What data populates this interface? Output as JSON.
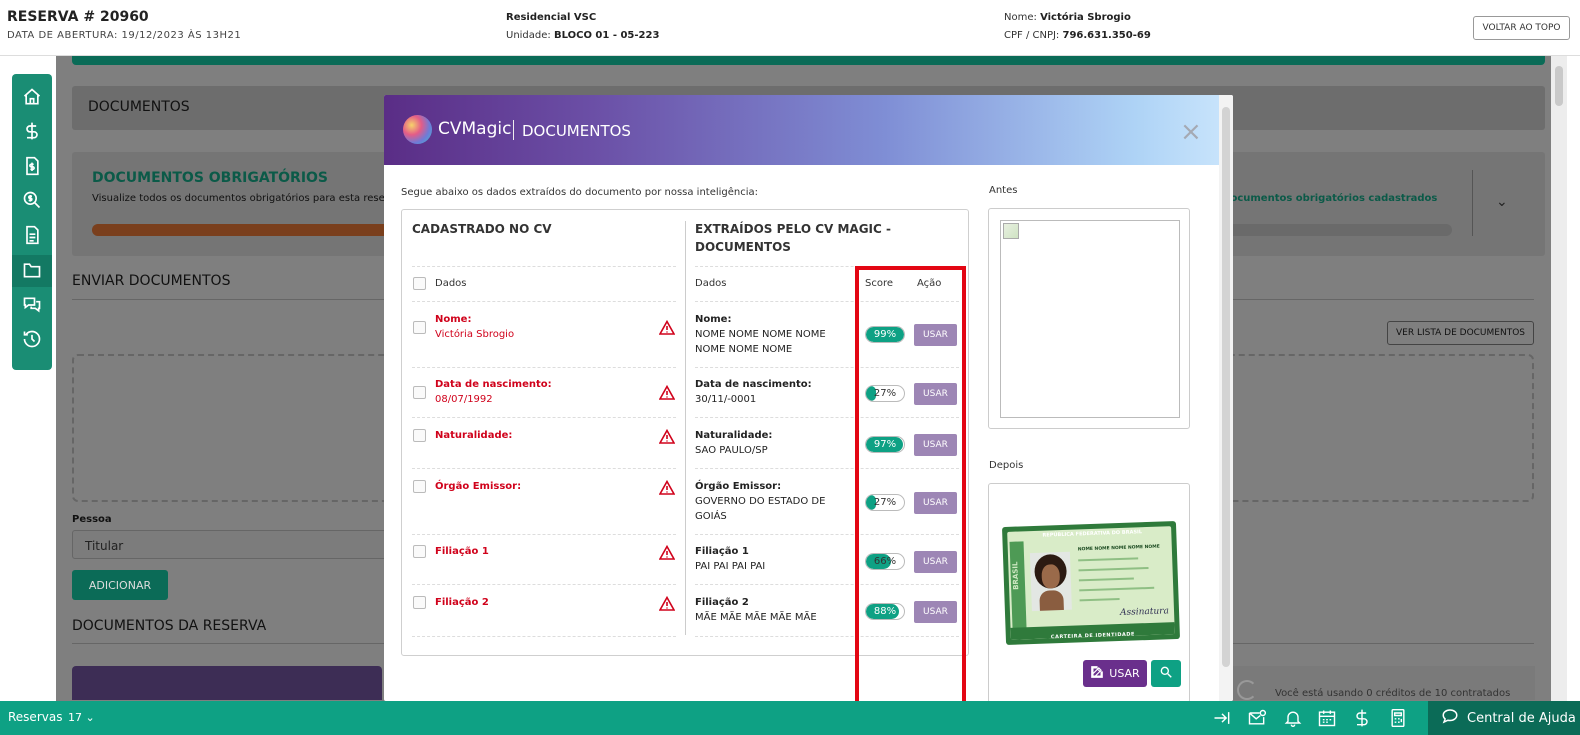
{
  "header": {
    "reserva_title": "RESERVA # 20960",
    "abertura": "DATA DE ABERTURA: 19/12/2023 ÀS 13H21",
    "empreendimento": "Residencial VSC",
    "unidade_label": "Unidade:",
    "unidade_value": "BLOCO 01 - 05-223",
    "nome_label": "Nome:",
    "nome_value": "Victória Sbrogio",
    "cpf_label": "CPF / CNPJ:",
    "cpf_value": "796.631.350-69",
    "back_to_top": "VOLTAR AO TOPO"
  },
  "sidebar": {
    "items": [
      {
        "icon": "home-icon"
      },
      {
        "icon": "dollar-icon"
      },
      {
        "icon": "invoice-icon"
      },
      {
        "icon": "search-dollar-icon"
      },
      {
        "icon": "document-icon"
      },
      {
        "icon": "folder-icon",
        "active": true
      },
      {
        "icon": "chat-icon"
      },
      {
        "icon": "history-icon"
      }
    ]
  },
  "background": {
    "documentos": "DOCUMENTOS",
    "obrigatorios_title": "DOCUMENTOS OBRIGATÓRIOS",
    "obrigatorios_sub": "Visualize todos os documentos obrigatórios para esta rese",
    "obrigatorios_right": "os documentos obrigatórios cadastrados",
    "enviar": "ENVIAR DOCUMENTOS",
    "ver_lista": "VER LISTA DE DOCUMENTOS",
    "pessoa_label": "Pessoa",
    "pessoa_value": "Titular",
    "adicionar": "ADICIONAR",
    "documentos_reserva": "DOCUMENTOS DA RESERVA",
    "credits_text": "Você está usando 0 créditos de 10 contratados"
  },
  "modal": {
    "brand": "CVMagic",
    "title": "DOCUMENTOS",
    "close": "×",
    "subtitle": "Segue abaixo os dados extraídos do documento por nossa inteligência:",
    "left_header": "CADASTRADO NO CV",
    "right_header_1": "EXTRAÍDOS PELO CV MAGIC -",
    "right_header_2": "DOCUMENTOS",
    "col_dados": "Dados",
    "col_dados_right": "Dados",
    "col_score": "Score",
    "col_acao": "Ação",
    "rows": [
      {
        "label": "Nome:",
        "cadastrado": "Victória Sbrogio",
        "extraido_label": "Nome:",
        "extraido_l1": "NOME NOME NOME NOME",
        "extraido_l2": "NOME NOME NOME",
        "score": 99,
        "score_text": "99%",
        "action": "USAR"
      },
      {
        "label": "Data de nascimento:",
        "cadastrado": "08/07/1992",
        "extraido_label": "Data de nascimento:",
        "extraido_l1": "30/11/-0001",
        "extraido_l2": "",
        "score": 27,
        "score_text": "27%",
        "action": "USAR"
      },
      {
        "label": "Naturalidade:",
        "cadastrado": "",
        "extraido_label": "Naturalidade:",
        "extraido_l1": "SAO PAULO/SP",
        "extraido_l2": "",
        "score": 97,
        "score_text": "97%",
        "action": "USAR"
      },
      {
        "label": "Órgão Emissor:",
        "cadastrado": "",
        "extraido_label": "Órgão Emissor:",
        "extraido_l1": "GOVERNO DO ESTADO DE",
        "extraido_l2": "GOIÁS",
        "score": 27,
        "score_text": "27%",
        "action": "USAR"
      },
      {
        "label": "Filiação 1",
        "cadastrado": "",
        "extraido_label": "Filiação 1",
        "extraido_l1": "PAI PAI PAI PAI",
        "extraido_l2": "",
        "score": 66,
        "score_text": "66%",
        "action": "USAR"
      },
      {
        "label": "Filiação 2",
        "cadastrado": "",
        "extraido_label": "Filiação 2",
        "extraido_l1": "MÃE MÃE MÃE MÃE MÃE",
        "extraido_l2": "",
        "score": 88,
        "score_text": "88%",
        "action": "USAR"
      }
    ],
    "antes_label": "Antes",
    "depois_label": "Depois",
    "id_card": {
      "top": "REPÚBLICA FEDERATIVA DO BRASIL",
      "side": "BRASIL",
      "name": "NOME NOME NOME NOME NOME",
      "bottom": "CARTEIRA DE IDENTIDADE",
      "signature": "Assinatura"
    },
    "usar_button": "USAR"
  },
  "bottombar": {
    "reservas_label": "Reservas",
    "reservas_count": "17",
    "help": "Central de Ajuda"
  },
  "colors": {
    "brand_teal": "#0ea184",
    "highlight_red": "#e30613",
    "usar_purple": "#9d86b5"
  }
}
